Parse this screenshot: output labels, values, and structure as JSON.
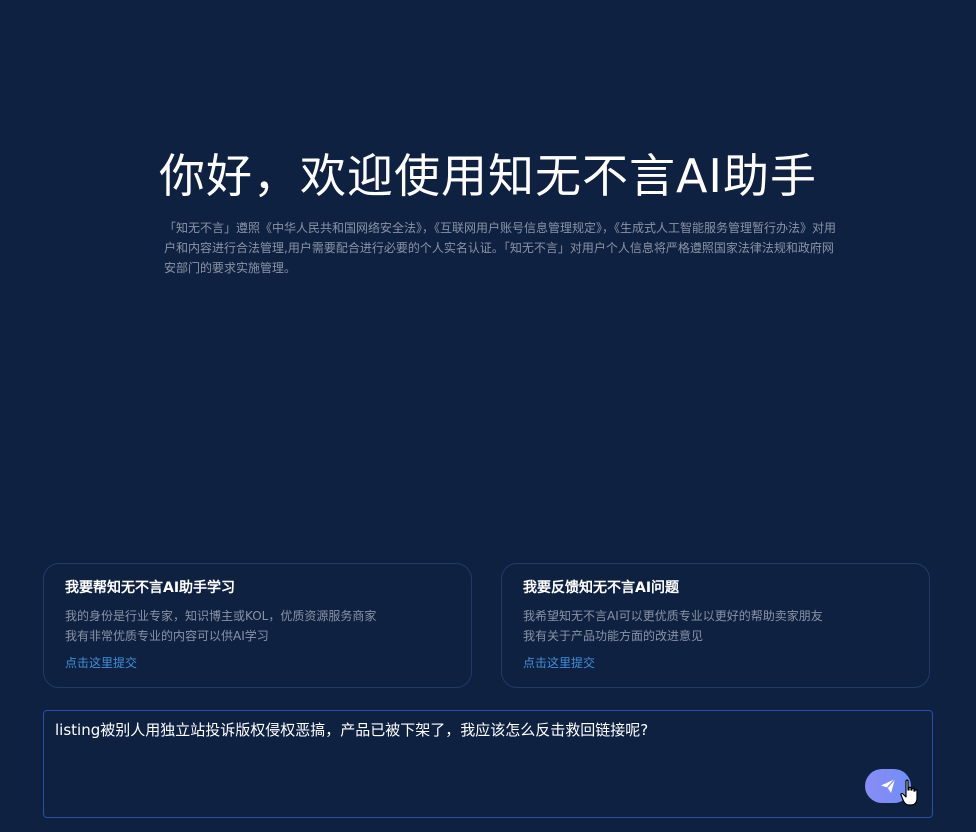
{
  "header": {
    "title": "你好，欢迎使用知无不言AI助手",
    "notice": "「知无不言」遵照《中华人民共和国网络安全法》，《互联网用户账号信息管理规定》，《生成式人工智能服务管理暂行办法》对用户和内容进行合法管理,用户需要配合进行必要的个人实名认证。「知无不言」对用户个人信息将严格遵照国家法律法规和政府网安部门的要求实施管理。"
  },
  "cards": [
    {
      "title": "我要帮知无不言AI助手学习",
      "line1": "我的身份是行业专家，知识博主或KOL，优质资源服务商家",
      "line2": "我有非常优质专业的内容可以供AI学习",
      "link": "点击这里提交"
    },
    {
      "title": "我要反馈知无不言AI问题",
      "line1": "我希望知无不言AI可以更优质专业以更好的帮助卖家朋友",
      "line2": "我有关于产品功能方面的改进意见",
      "link": "点击这里提交"
    }
  ],
  "composer": {
    "value": "listing被别人用独立站投诉版权侵权恶搞，产品已被下架了，我应该怎么反击救回链接呢?"
  },
  "icons": {
    "send": "paper-plane-icon",
    "cursor": "hand-pointer-icon"
  },
  "colors": {
    "background": "#0f2140",
    "accent": "#7b8df6",
    "link": "#3f8fd8"
  }
}
